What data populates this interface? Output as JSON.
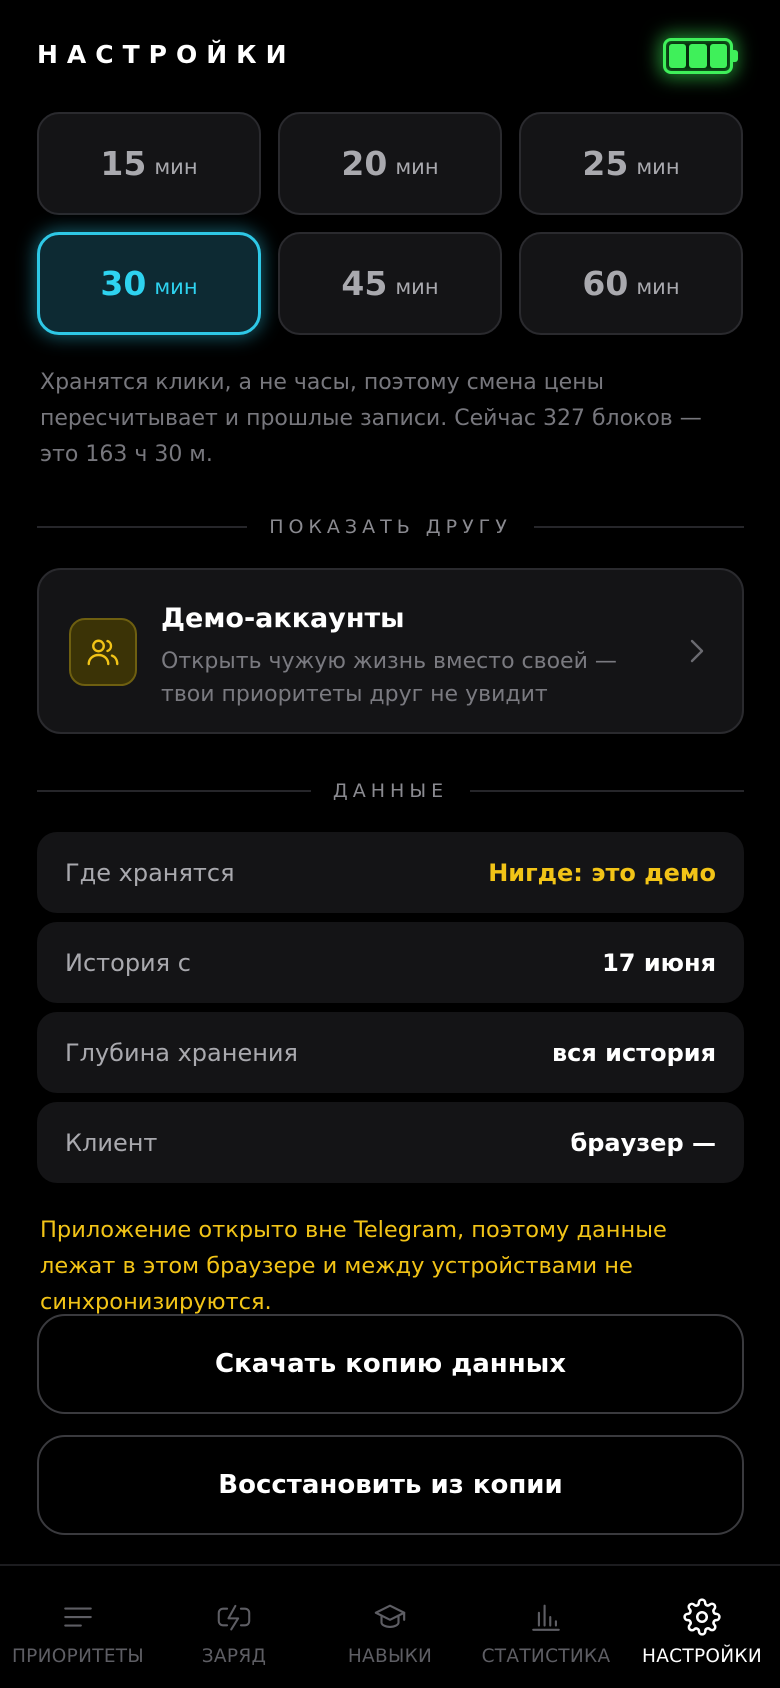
{
  "header": {
    "title": "НАСТРОЙКИ",
    "battery_icon": "battery-full-icon"
  },
  "intervals": [
    {
      "value": "15",
      "unit": "мин",
      "active": false
    },
    {
      "value": "20",
      "unit": "мин",
      "active": false
    },
    {
      "value": "25",
      "unit": "мин",
      "active": false
    },
    {
      "value": "30",
      "unit": "мин",
      "active": true
    },
    {
      "value": "45",
      "unit": "мин",
      "active": false
    },
    {
      "value": "60",
      "unit": "мин",
      "active": false
    }
  ],
  "interval_note": "Хранятся клики, а не часы, поэтому смена цены пересчитывает и прошлые записи. Сейчас 327 блоков — это 163 ч 30 м.",
  "share_section": {
    "heading": "ПОКАЗАТЬ ДРУГУ",
    "demo_card": {
      "icon": "users-icon",
      "title": "Демо-аккаунты",
      "subtitle": "Открыть чужую жизнь вместо своей — твои приоритеты друг не увидит"
    }
  },
  "data_section": {
    "heading": "ДАННЫЕ",
    "rows": [
      {
        "label": "Где хранятся",
        "value": "Нигде: это демо",
        "highlight": true
      },
      {
        "label": "История с",
        "value": "17 июня",
        "highlight": false
      },
      {
        "label": "Глубина хранения",
        "value": "вся история",
        "highlight": false
      },
      {
        "label": "Клиент",
        "value": "браузер —",
        "highlight": false
      }
    ],
    "warning": "Приложение открыто вне Telegram, поэтому данные лежат в этом браузере и между устройствами не синхронизируются.",
    "download_label": "Скачать копию данных",
    "restore_label": "Восстановить из копии"
  },
  "tabbar": [
    {
      "label": "ПРИОРИТЕТЫ",
      "icon": "list-icon",
      "active": false
    },
    {
      "label": "ЗАРЯД",
      "icon": "charge-icon",
      "active": false
    },
    {
      "label": "НАВЫКИ",
      "icon": "graduation-cap-icon",
      "active": false
    },
    {
      "label": "СТАТИСТИКА",
      "icon": "bar-chart-icon",
      "active": false
    },
    {
      "label": "НАСТРОЙКИ",
      "icon": "gear-icon",
      "active": true
    }
  ],
  "colors": {
    "accent_cyan": "#2ec8e6",
    "warning_yellow": "#f2c417",
    "battery_green": "#3ff05a"
  }
}
